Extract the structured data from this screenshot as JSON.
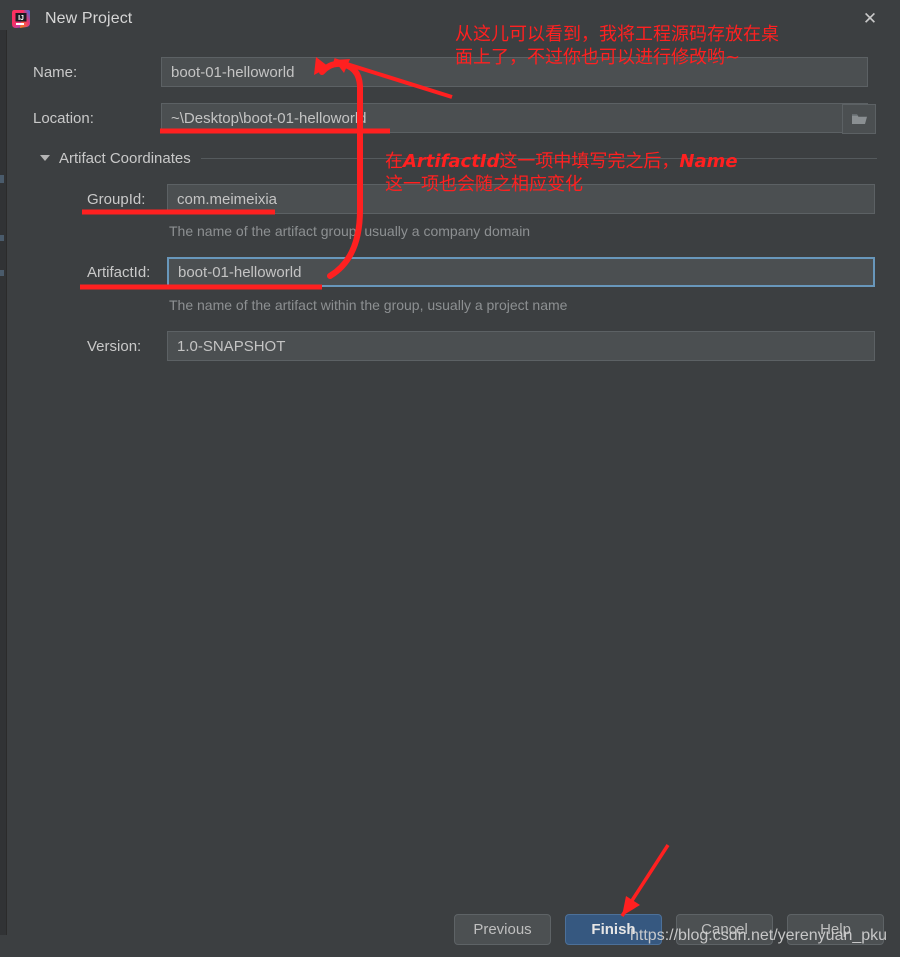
{
  "window": {
    "title": "New Project",
    "icon": "intellij-idea-icon",
    "close_label": "✕"
  },
  "form": {
    "name": {
      "label": "Name:",
      "value": "boot-01-helloworld"
    },
    "location": {
      "label": "Location:",
      "value": "~\\Desktop\\boot-01-helloworld",
      "browse_icon": "folder-icon"
    },
    "section": {
      "label": "Artifact Coordinates",
      "expanded_icon": "chevron-down-icon"
    },
    "group_id": {
      "label": "GroupId:",
      "value": "com.meimeixia",
      "hint": "The name of the artifact group, usually a company domain"
    },
    "artifact_id": {
      "label": "ArtifactId:",
      "value": "boot-01-helloworld",
      "hint": "The name of the artifact within the group, usually a project name",
      "focused": true
    },
    "version": {
      "label": "Version:",
      "value": "1.0-SNAPSHOT"
    }
  },
  "buttons": [
    {
      "label": "Previous",
      "primary": false
    },
    {
      "label": "Finish",
      "primary": true
    },
    {
      "label": "Cancel",
      "primary": false
    },
    {
      "label": "Help",
      "primary": false
    }
  ],
  "annotations": {
    "top_line1": "从这儿可以看到，我将工程源码存放在桌",
    "top_line2": "面上了，不过你也可以进行修改哟~",
    "mid_line1_pre": "在",
    "mid_line1_em": "ArtifactId",
    "mid_line1_post": "这一项中填写完之后，",
    "mid_line1_em2": "Name",
    "mid_line2": "这一项也会随之相应变化",
    "color": "#ff2020"
  },
  "watermark": {
    "text": "https://blog.csdn.net/yerenyuan_pku"
  },
  "colors": {
    "dialog_bg": "#3c3f41",
    "field_bg": "#4b4f51",
    "focus_border": "#6897bb",
    "primary_button": "#365880",
    "annotation_red": "#ff2020"
  }
}
